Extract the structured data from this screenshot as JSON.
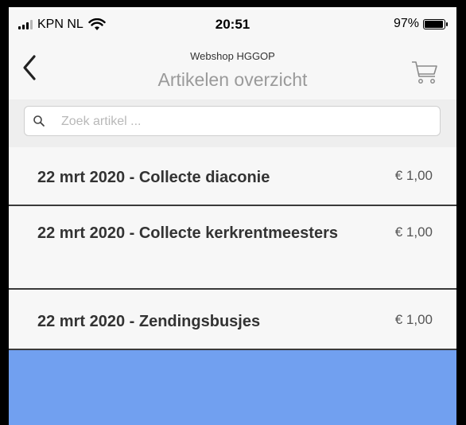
{
  "status": {
    "carrier": "KPN NL",
    "time": "20:51",
    "battery": "97%",
    "battery_level": 0.97
  },
  "nav": {
    "subtitle": "Webshop HGGOP",
    "title": "Artikelen overzicht"
  },
  "search": {
    "placeholder": "Zoek artikel ...",
    "value": ""
  },
  "items": [
    {
      "name": "22 mrt 2020 - Collecte diaconie",
      "price": "€ 1,00"
    },
    {
      "name": "22 mrt 2020 - Collecte kerkrentmeesters",
      "price": "€ 1,00"
    },
    {
      "name": "22 mrt 2020 - Zendingsbusjes",
      "price": "€ 1,00"
    }
  ],
  "colors": {
    "accent_bar": "#71a0f0",
    "title_gray": "#9a9a9a"
  },
  "icons": [
    "signal-icon",
    "wifi-icon",
    "battery-icon",
    "back-chevron-icon",
    "cart-icon",
    "search-icon"
  ]
}
